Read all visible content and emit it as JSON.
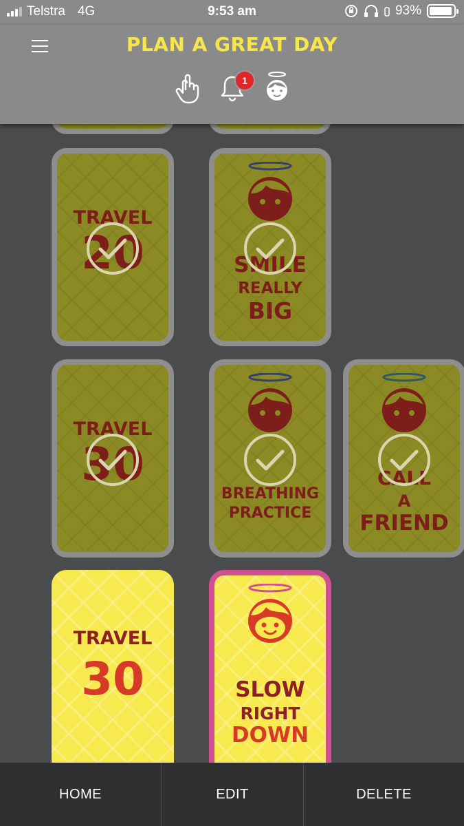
{
  "status_bar": {
    "carrier": "Telstra",
    "network": "4G",
    "time": "9:53 am",
    "battery": "93%",
    "battery_level": 0.93
  },
  "header": {
    "title": "PLAN A GREAT DAY",
    "notification_count": "1",
    "icons": [
      "menu-icon",
      "hand-pointer-icon",
      "bell-icon",
      "angel-face-icon"
    ]
  },
  "cards": [
    {
      "line1": "TRAVEL",
      "line2": "20",
      "done": true
    },
    {
      "line1": "SMILE",
      "line2": "REALLY",
      "line3": "BIG",
      "done": true
    },
    {
      "line1": "TRAVEL",
      "line2": "30",
      "done": true
    },
    {
      "line1": "BREATHING",
      "line2": "PRACTICE",
      "done": true
    },
    {
      "line1": "CALL",
      "line2": "A",
      "line3": "FRIEND",
      "done": true
    },
    {
      "line1": "TRAVEL",
      "line2": "30",
      "done": false
    },
    {
      "line1": "SLOW",
      "line2": "RIGHT",
      "line3": "DOWN",
      "done": false,
      "selected": true
    }
  ],
  "bottom_bar": {
    "home": "HOME",
    "edit": "EDIT",
    "delete": "DELETE"
  },
  "colors": {
    "title_yellow": "#f5e64c",
    "card_yellow": "#f7e94e",
    "card_done": "#8b8a25",
    "selected_border": "#d04f92",
    "badge_red": "#e0252b"
  }
}
